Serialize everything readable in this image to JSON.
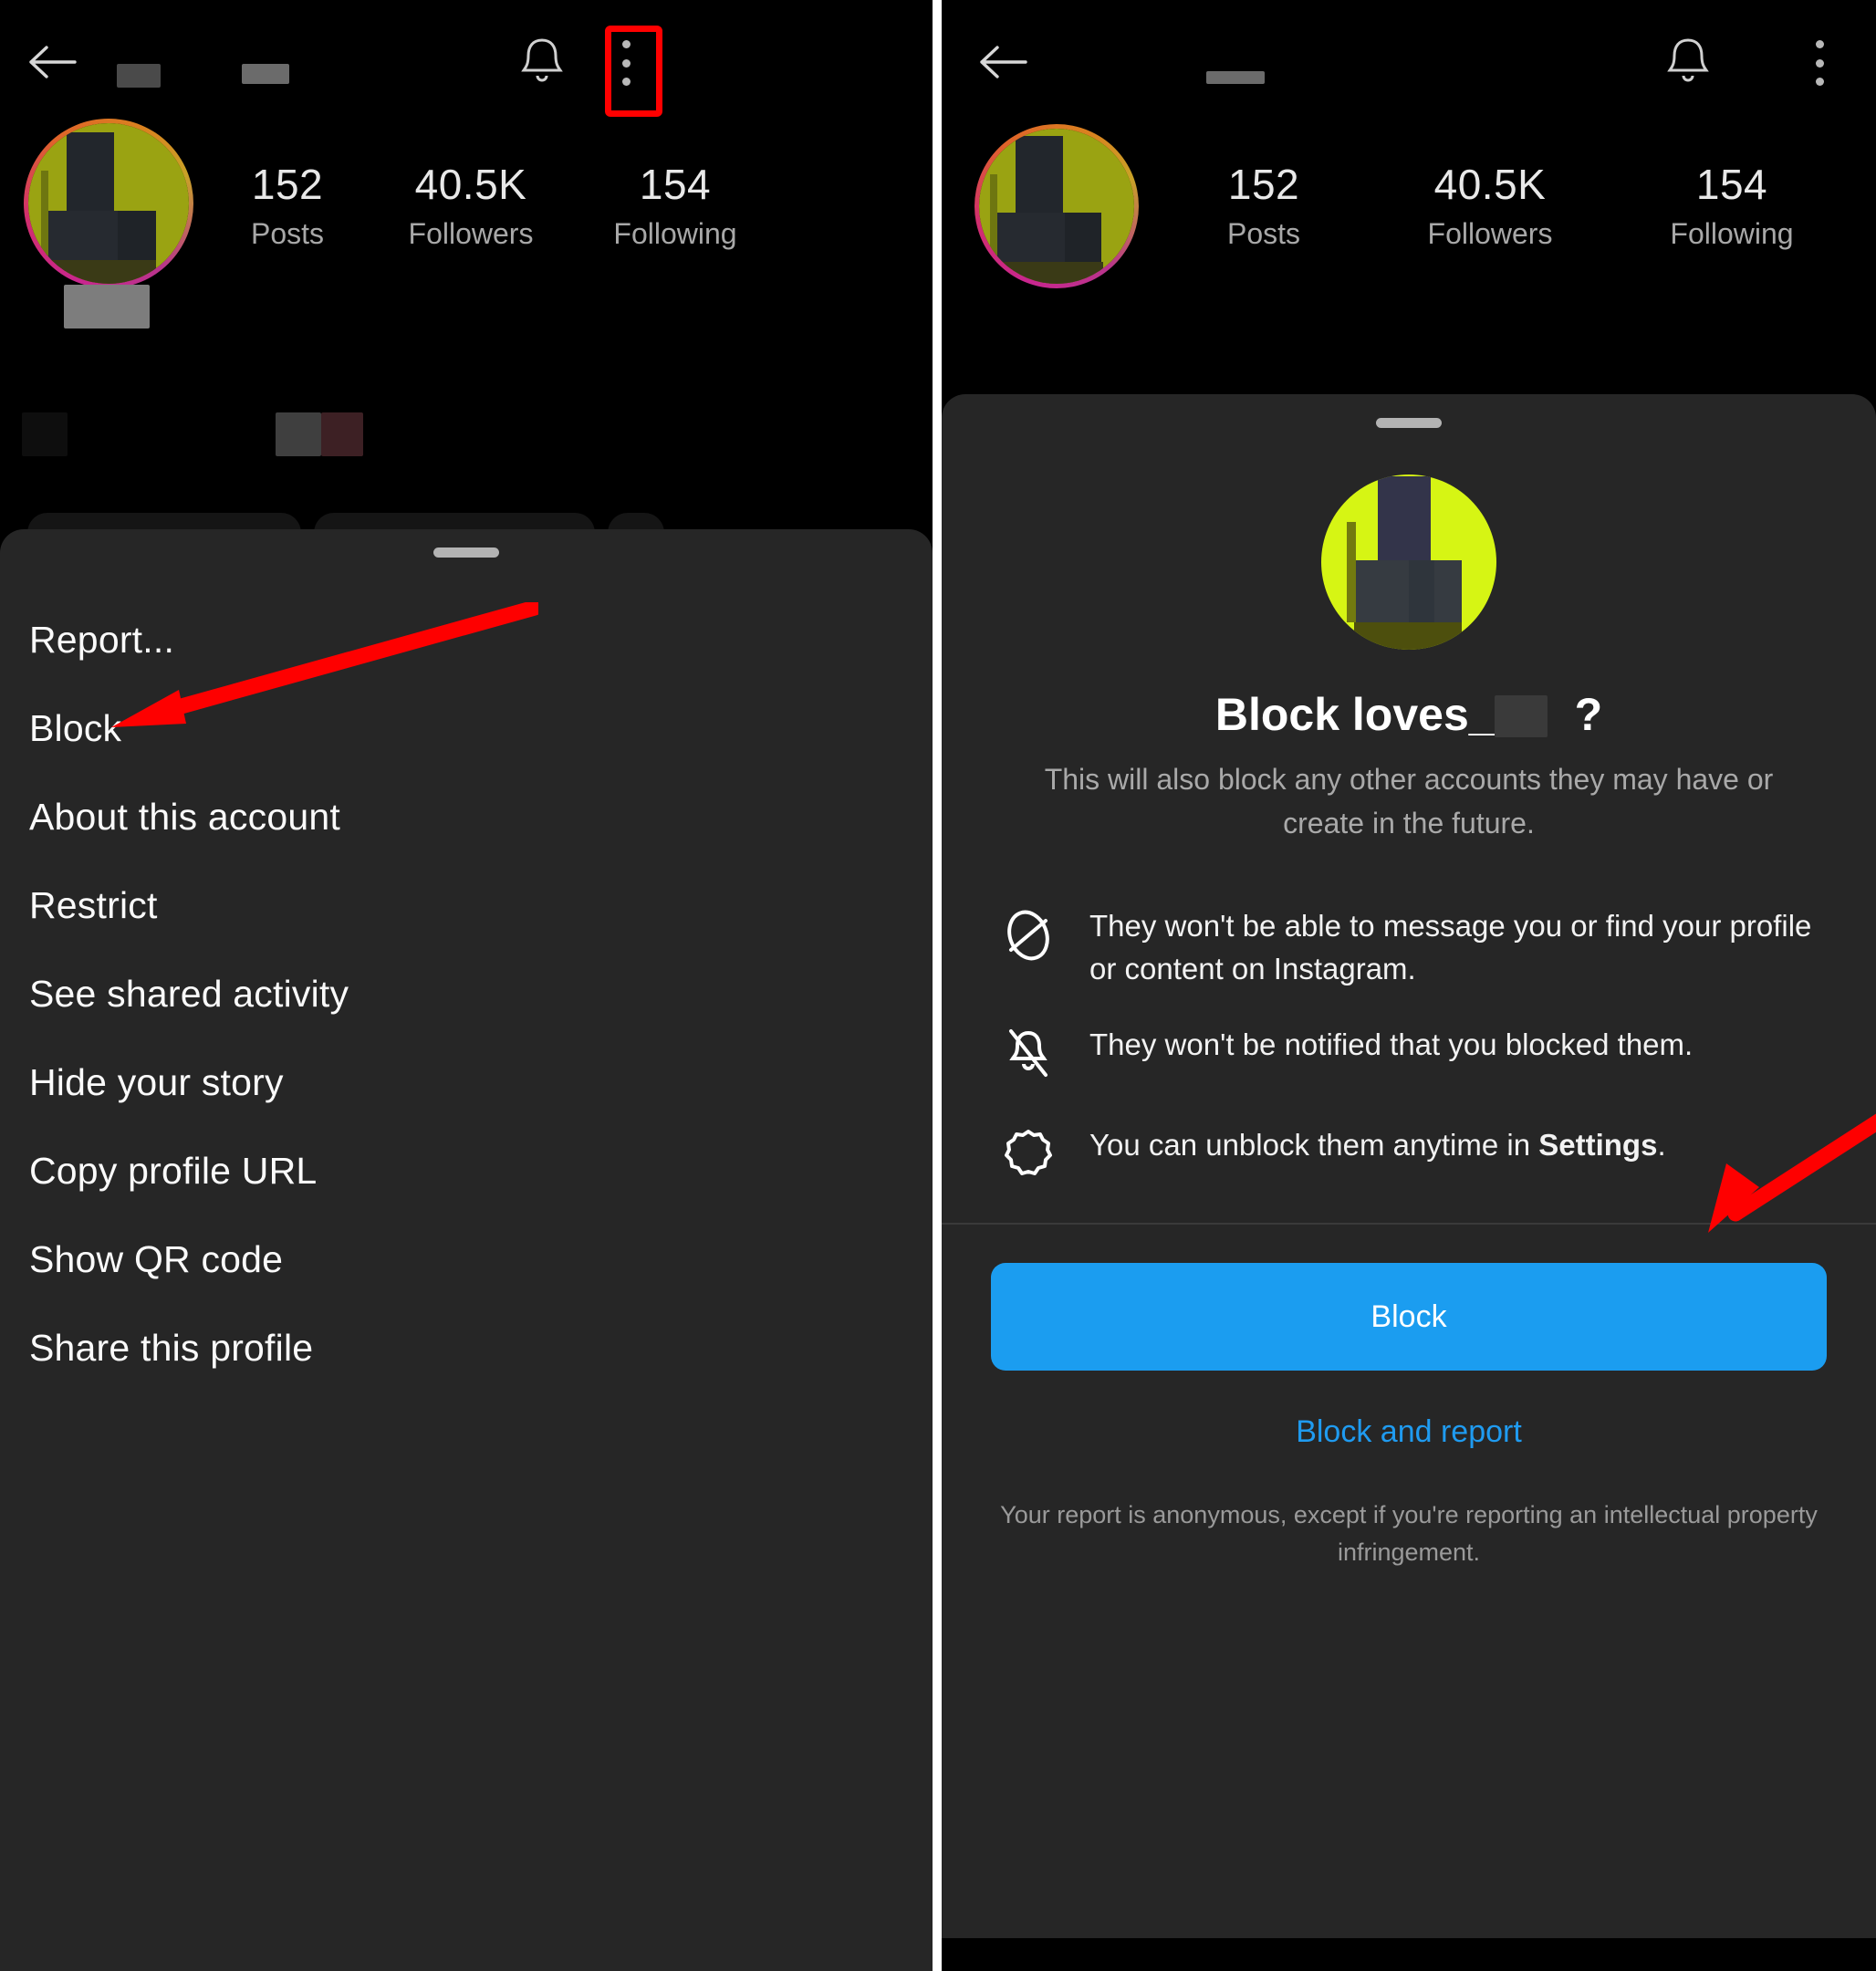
{
  "left_panel": {
    "appbar": {
      "back_icon": "back-arrow-icon",
      "bell_icon": "notification-bell-icon",
      "overflow_icon": "three-dot-menu-icon",
      "username_redacted": true
    },
    "profile": {
      "stats": [
        {
          "number": "152",
          "label": "Posts"
        },
        {
          "number": "40.5K",
          "label": "Followers"
        },
        {
          "number": "154",
          "label": "Following"
        }
      ]
    },
    "menu_sheet": {
      "handle": "drag-handle",
      "items": [
        "Report...",
        "Block",
        "About this account",
        "Restrict",
        "See shared activity",
        "Hide your story",
        "Copy profile URL",
        "Show QR code",
        "Share this profile"
      ]
    },
    "annotations": {
      "highlight_color": "#ff0000",
      "highlight_target": "three-dot-menu-icon",
      "arrow_target": "Block"
    }
  },
  "right_panel": {
    "appbar": {
      "back_icon": "back-arrow-icon",
      "bell_icon": "notification-bell-icon",
      "overflow_icon": "three-dot-menu-icon"
    },
    "profile": {
      "stats": [
        {
          "number": "152",
          "label": "Posts"
        },
        {
          "number": "40.5K",
          "label": "Followers"
        },
        {
          "number": "154",
          "label": "Following"
        }
      ]
    },
    "block_dialog": {
      "handle": "drag-handle",
      "title_prefix": "Block loves_",
      "title_suffix": "?",
      "subtitle": "This will also block any other accounts they may have or create in the future.",
      "features": [
        {
          "icon": "no-message-icon",
          "text": "They won't be able to message you or find your profile or content on Instagram."
        },
        {
          "icon": "bell-off-icon",
          "text": "They won't be notified that you blocked them."
        },
        {
          "icon": "gear-icon",
          "text_before": "You can unblock them anytime in ",
          "text_bold": "Settings",
          "text_after": "."
        }
      ],
      "primary_button": "Block",
      "secondary_link": "Block and report",
      "footnote": "Your report is anonymous, except if you're reporting an intellectual property infringement.",
      "primary_button_color": "#1b9df0",
      "link_color": "#1f9bf0"
    },
    "annotations": {
      "arrow_target": "Block"
    }
  }
}
